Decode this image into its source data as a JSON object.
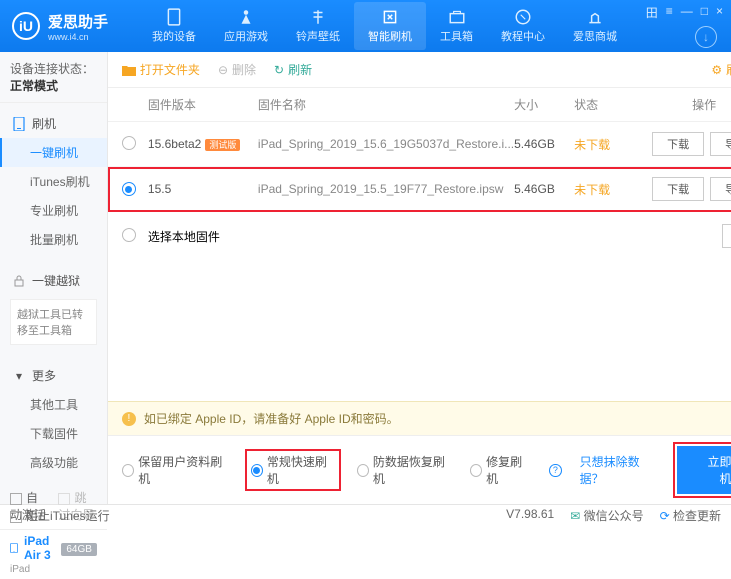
{
  "brand": {
    "name": "爱思助手",
    "url": "www.i4.cn",
    "logo": "iU"
  },
  "winctl": [
    "田",
    "≡",
    "—",
    "□",
    "×"
  ],
  "nav": [
    {
      "label": "我的设备"
    },
    {
      "label": "应用游戏"
    },
    {
      "label": "铃声壁纸"
    },
    {
      "label": "智能刷机",
      "active": true
    },
    {
      "label": "工具箱"
    },
    {
      "label": "教程中心"
    },
    {
      "label": "爱思商城"
    }
  ],
  "conn": {
    "prefix": "设备连接状态：",
    "status": "正常模式"
  },
  "sidebar": {
    "flash": {
      "head": "刷机",
      "items": [
        "一键刷机",
        "iTunes刷机",
        "专业刷机",
        "批量刷机"
      ],
      "activeIndex": 0
    },
    "jailbreak": {
      "head": "一键越狱",
      "notice": "越狱工具已转移至工具箱"
    },
    "more": {
      "head": "更多",
      "items": [
        "其他工具",
        "下载固件",
        "高级功能"
      ]
    }
  },
  "deviceRow": {
    "autoActivate": "自动激活",
    "skipGuide": "跳过向导"
  },
  "device": {
    "name": "iPad Air 3",
    "cap": "64GB",
    "type": "iPad"
  },
  "toolbar": {
    "open": "打开文件夹",
    "delete": "删除",
    "refresh": "刷新",
    "settings": "刷机设置"
  },
  "table": {
    "headers": {
      "ver": "固件版本",
      "name": "固件名称",
      "size": "大小",
      "state": "状态",
      "ops": "操作"
    },
    "rows": [
      {
        "ver": "15.6beta2",
        "badge": "测试版",
        "name": "iPad_Spring_2019_15.6_19G5037d_Restore.i...",
        "size": "5.46GB",
        "state": "未下载",
        "selected": false
      },
      {
        "ver": "15.5",
        "badge": "",
        "name": "iPad_Spring_2019_15.5_19F77_Restore.ipsw",
        "size": "5.46GB",
        "state": "未下载",
        "selected": true
      }
    ],
    "btn": {
      "download": "下载",
      "import": "导入"
    },
    "local": "选择本地固件"
  },
  "warn": "如已绑定 Apple ID，请准备好 Apple ID和密码。",
  "modes": {
    "items": [
      "保留用户资料刷机",
      "常规快速刷机",
      "防数据恢复刷机",
      "修复刷机"
    ],
    "checkedIndex": 1,
    "link": "只想抹除数据？",
    "go": "立即刷机"
  },
  "footer": {
    "block": "阻止iTunes运行",
    "ver": "V7.98.61",
    "wechat": "微信公众号",
    "update": "检查更新"
  }
}
